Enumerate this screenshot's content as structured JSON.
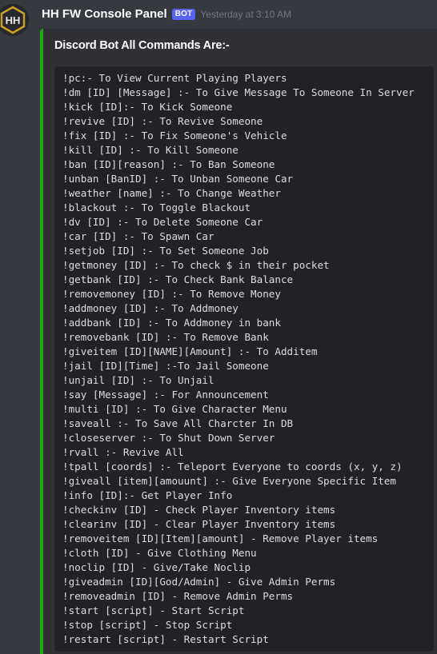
{
  "message": {
    "username": "HH FW Console Panel",
    "bot_tag": "BOT",
    "timestamp": "Yesterday at 3:10 AM"
  },
  "embed": {
    "accent_color": "#1eaa16",
    "title": "Discord Bot All Commands Are:-",
    "commands": [
      "!pc:- To View Current Playing Players",
      "!dm [ID] [Message] :- To Give Message To Someone In Server",
      "!kick [ID]:- To Kick Someone",
      "!revive [ID] :- To Revive Someone",
      "!fix [ID] :- To Fix Someone's Vehicle",
      "!kill [ID] :- To Kill Someone",
      "!ban [ID][reason] :- To Ban Someone",
      "!unban [BanID] :- To Unban Someone Car",
      "!weather [name] :- To Change Weather",
      "!blackout :- To Toggle Blackout",
      "!dv [ID] :- To Delete Someone Car",
      "!car [ID] :- To Spawn Car",
      "!setjob [ID] :- To Set Someone Job",
      "!getmoney [ID] :- To check $ in their pocket",
      "!getbank [ID] :- To Check Bank Balance",
      "!removemoney [ID] :- To Remove Money",
      "!addmoney [ID] :- To Addmoney",
      "!addbank [ID] :- To Addmoney in bank",
      "!removebank [ID] :- To Remove Bank",
      "!giveitem [ID][NAME][Amount] :- To Additem",
      "!jail [ID][Time] :-To Jail Someone",
      "!unjail [ID] :- To Unjail",
      "!say [Message] :- For Announcement",
      "!multi [ID] :- To Give Character Menu",
      "!saveall :- To Save All Charcter In DB",
      "!closeserver :- To Shut Down Server",
      "!rvall :- Revive All",
      "!tpall [coords] :- Teleport Everyone to coords (x, y, z)",
      "!giveall [item][amouunt] :- Give Everyone Specific Item",
      "!info [ID]:- Get Player Info",
      "!checkinv [ID] - Check Player Inventory items",
      "!clearinv [ID] - Clear Player Inventory items",
      "!removeitem [ID][Item][amount] - Remove Player items",
      "!cloth [ID] - Give Clothing Menu",
      "!noclip [ID] - Give/Take Noclip",
      "!giveadmin [ID][God/Admin] - Give Admin Perms",
      "!removeadmin [ID] - Remove Admin Perms",
      "!start [script] - Start Script",
      "!stop [script] - Stop Script",
      "!restart [script] - Restart Script"
    ]
  }
}
